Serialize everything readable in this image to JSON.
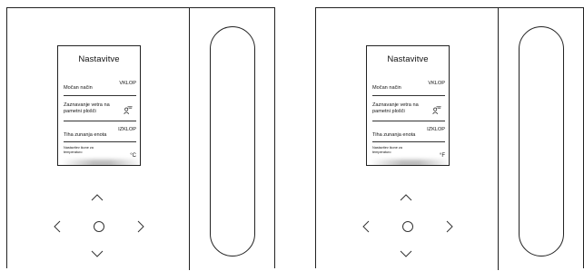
{
  "panels": [
    {
      "title": "Nastavitve",
      "rows": [
        {
          "label": "Močan način",
          "value": "VKLOP"
        },
        {
          "label": "Zaznavanje vetra na pametni plošči",
          "icon": "person-wind-icon"
        },
        {
          "label": "Tiha zunanja enota",
          "value": "IZKLOP"
        },
        {
          "label": "Nastavitev ikone za temperaturo",
          "value": "°C"
        }
      ]
    },
    {
      "title": "Nastavitve",
      "rows": [
        {
          "label": "Močan način",
          "value": "VKLOP"
        },
        {
          "label": "Zaznavanje vetra na pametni plošči",
          "icon": "person-wind-icon"
        },
        {
          "label": "Tiha zunanja enota",
          "value": "IZKLOP"
        },
        {
          "label": "Nastavitev ikone za temperaturo",
          "value": "°F"
        }
      ]
    }
  ],
  "controls": [
    "up-arrow-icon",
    "left-arrow-icon",
    "ok-button",
    "right-arrow-icon",
    "down-arrow-icon"
  ]
}
